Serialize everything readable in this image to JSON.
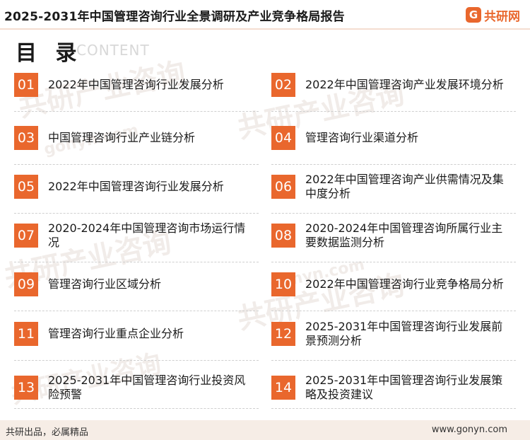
{
  "header": {
    "title": "2025-2031年中国管理咨询行业全景调研及产业竞争格局报告",
    "logo_mark": "G",
    "logo_text": "共研网"
  },
  "contents": {
    "title_cn": "目 录",
    "title_en": "CONTENT"
  },
  "watermark": {
    "brand": "共研产业咨询",
    "domain": "gonyn.com"
  },
  "toc": [
    {
      "num": "01",
      "label": "2022年中国管理咨询行业发展分析"
    },
    {
      "num": "02",
      "label": "2022年中国管理咨询产业发展环境分析"
    },
    {
      "num": "03",
      "label": "中国管理咨询行业产业链分析"
    },
    {
      "num": "04",
      "label": "管理咨询行业渠道分析"
    },
    {
      "num": "05",
      "label": "2022年中国管理咨询行业发展分析"
    },
    {
      "num": "06",
      "label": "2022年中国管理咨询产业供需情况及集中度分析"
    },
    {
      "num": "07",
      "label": "2020-2024年中国管理咨询市场运行情况"
    },
    {
      "num": "08",
      "label": "2020-2024年中国管理咨询所属行业主要数据监测分析"
    },
    {
      "num": "09",
      "label": "管理咨询行业区域分析"
    },
    {
      "num": "10",
      "label": "2022年中国管理咨询行业竞争格局分析"
    },
    {
      "num": "11",
      "label": "管理咨询行业重点企业分析"
    },
    {
      "num": "12",
      "label": "2025-2031年中国管理咨询行业发展前景预测分析"
    },
    {
      "num": "13",
      "label": "2025-2031年中国管理咨询行业投资风险预警"
    },
    {
      "num": "14",
      "label": "2025-2031年中国管理咨询行业发展策略及投资建议"
    }
  ],
  "footer": {
    "slogan": "共研出品，必属精品",
    "url": "www.gonyn.com"
  }
}
